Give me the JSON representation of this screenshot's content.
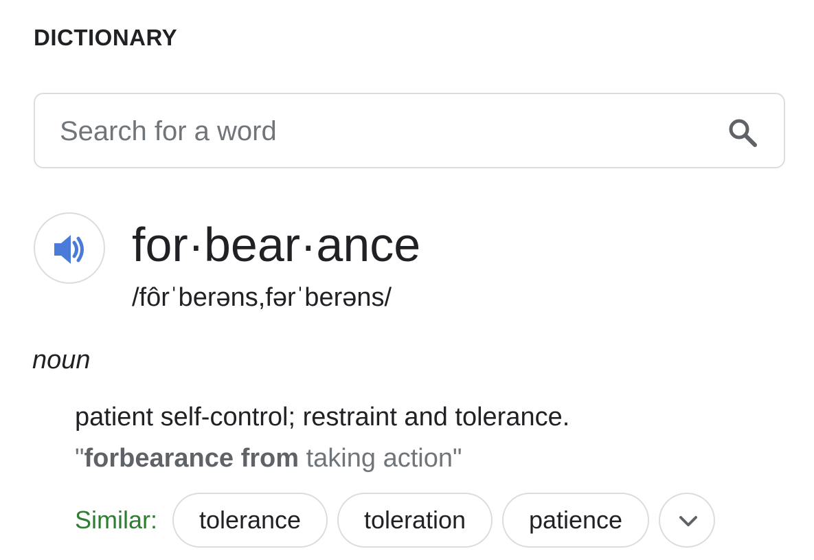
{
  "section": {
    "title": "DICTIONARY"
  },
  "search": {
    "placeholder": "Search for a word",
    "value": "",
    "icon": "search-icon"
  },
  "entry": {
    "audio_icon": "speaker-icon",
    "audio_color": "#4a7bd8",
    "headword": "for·bear·ance",
    "phonetic": "/fôrˈberəns,fərˈberəns/",
    "part_of_speech": "noun",
    "definition": "patient self-control; restraint and tolerance.",
    "example": {
      "open_quote": "\"",
      "bold": "forbearance from",
      "rest": " taking action",
      "close_quote": "\""
    },
    "similar": {
      "label": "Similar:",
      "label_color": "#2e7d32",
      "words": [
        "tolerance",
        "toleration",
        "patience"
      ],
      "more_icon": "chevron-down-icon"
    }
  }
}
